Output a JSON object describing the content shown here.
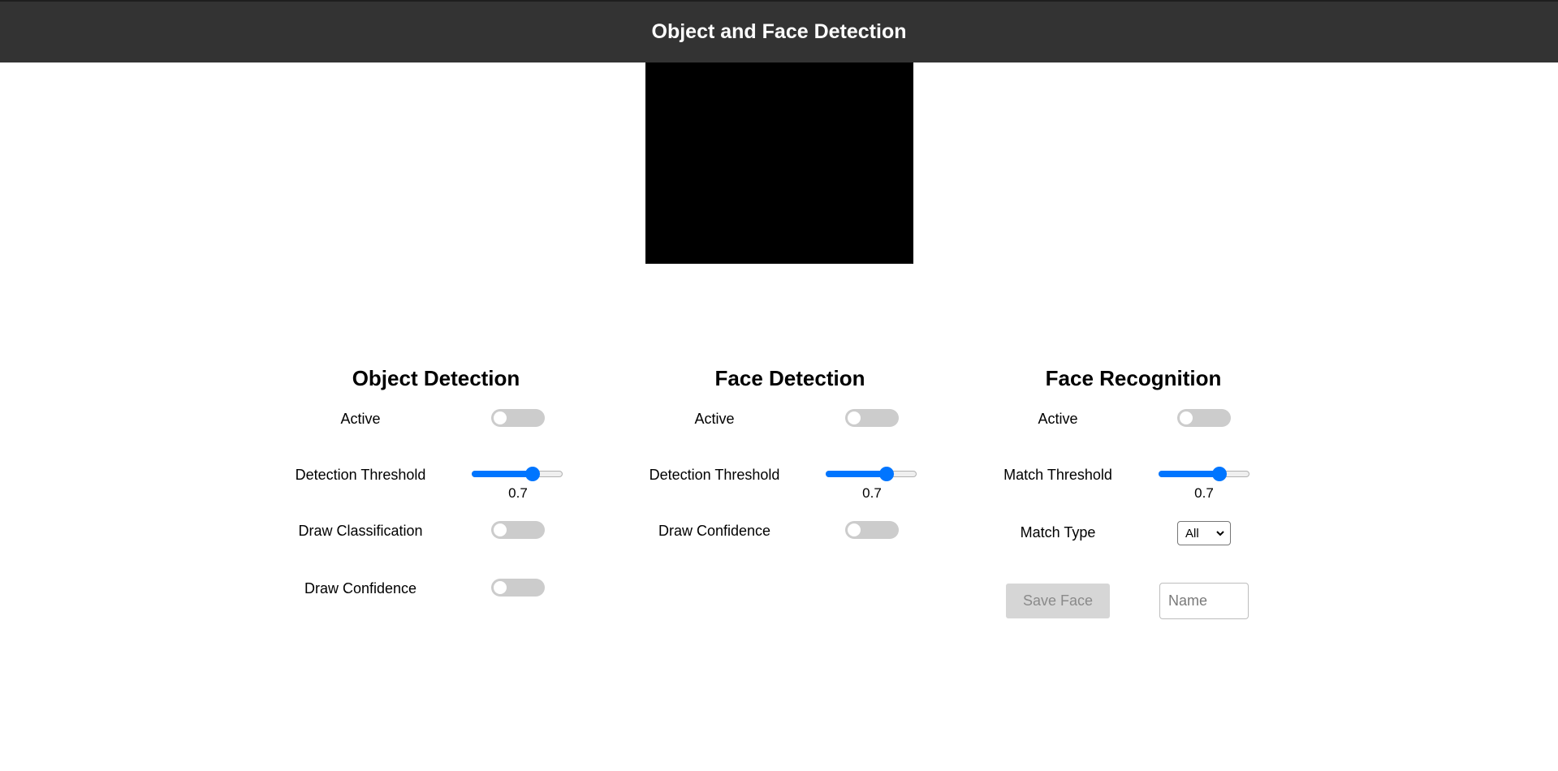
{
  "header": {
    "title": "Object and Face Detection"
  },
  "object_detection": {
    "title": "Object Detection",
    "active_label": "Active",
    "active": false,
    "threshold_label": "Detection Threshold",
    "threshold_value": "0.7",
    "threshold": 0.7,
    "draw_classification_label": "Draw Classification",
    "draw_classification": false,
    "draw_confidence_label": "Draw Confidence",
    "draw_confidence": false
  },
  "face_detection": {
    "title": "Face Detection",
    "active_label": "Active",
    "active": false,
    "threshold_label": "Detection Threshold",
    "threshold_value": "0.7",
    "threshold": 0.7,
    "draw_confidence_label": "Draw Confidence",
    "draw_confidence": false
  },
  "face_recognition": {
    "title": "Face Recognition",
    "active_label": "Active",
    "active": false,
    "threshold_label": "Match Threshold",
    "threshold_value": "0.7",
    "threshold": 0.7,
    "match_type_label": "Match Type",
    "match_type_value": "All",
    "save_button_label": "Save Face",
    "name_placeholder": "Name"
  },
  "colors": {
    "header_bg": "#333333",
    "accent": "#0075ff",
    "toggle_off": "#cccccc",
    "video_bg": "#000000"
  },
  "icons": {
    "select_caret": "chevron-down-icon"
  }
}
